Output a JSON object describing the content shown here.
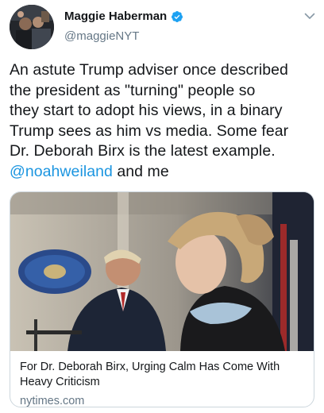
{
  "author": {
    "name": "Maggie Haberman",
    "handle": "@maggieNYT",
    "verified": true,
    "avatar_icon": "profile-photo"
  },
  "tweet": {
    "lines": [
      "An astute Trump adviser once described",
      "the president as \"turning\" people so",
      "they start to adopt his views, in a binary",
      "Trump sees as him vs media. Some fear",
      "Dr. Deborah Birx is the latest example."
    ],
    "mention": "@noahweiland",
    "mention_suffix": " and me"
  },
  "card": {
    "title": "For Dr. Deborah Birx, Urging Calm Has Come With Heavy Criticism",
    "domain": "nytimes.com",
    "image_icon": "news-photo"
  },
  "colors": {
    "link": "#1b95e0",
    "verified": "#1da1f2",
    "secondary_text": "#657786",
    "border": "#ccd6dd"
  }
}
